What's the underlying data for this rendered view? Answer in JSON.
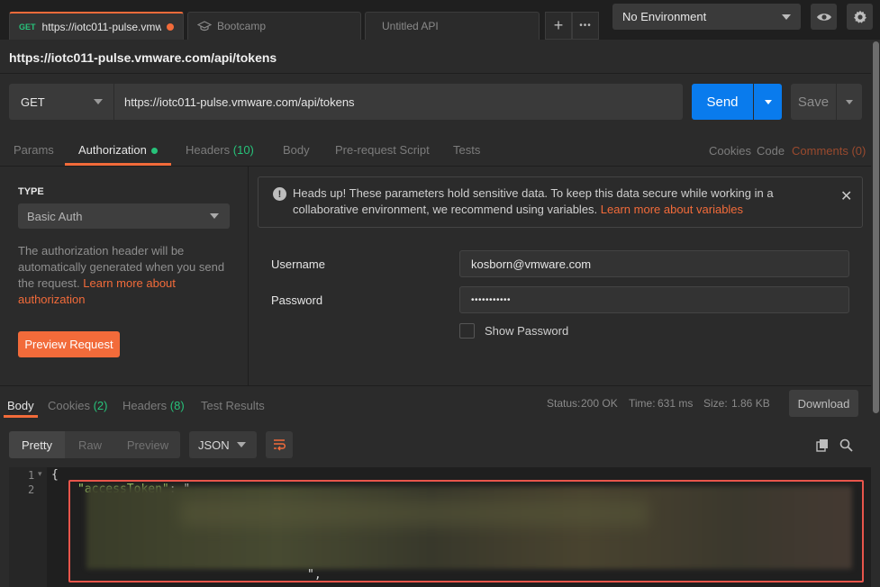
{
  "tabs": [
    {
      "method": "GET",
      "label": "https://iotc011-pulse.vmwa",
      "active": true
    },
    {
      "label": "Bootcamp"
    },
    {
      "label": "Untitled API"
    }
  ],
  "tabbar": {
    "add_label": "+",
    "more_label": "•••"
  },
  "environment": {
    "selected": "No Environment"
  },
  "request": {
    "title": "https://iotc011-pulse.vmware.com/api/tokens",
    "method": "GET",
    "url": "https://iotc011-pulse.vmware.com/api/tokens",
    "send_label": "Send",
    "save_label": "Save"
  },
  "request_tabs": {
    "params": "Params",
    "authorization": "Authorization",
    "headers": "Headers",
    "headers_count": "(10)",
    "body": "Body",
    "prerequest": "Pre-request Script",
    "tests": "Tests",
    "cookies": "Cookies",
    "code": "Code",
    "comments": "Comments (0)"
  },
  "auth": {
    "type_label": "TYPE",
    "type_value": "Basic Auth",
    "desc": "The authorization header will be automatically generated when you send the request. ",
    "desc_link": "Learn more about authorization",
    "preview_label": "Preview Request",
    "notice": "Heads up! These parameters hold sensitive data. To keep this data secure while working in a collaborative environment, we recommend using variables. ",
    "notice_link": "Learn more about variables",
    "username_label": "Username",
    "username_value": "kosborn@vmware.com",
    "password_label": "Password",
    "password_value": "•••••••••••",
    "show_password": "Show Password"
  },
  "response": {
    "tabs": {
      "body": "Body",
      "cookies": "Cookies",
      "cookies_count": "(2)",
      "headers": "Headers",
      "headers_count": "(8)",
      "tests": "Test Results"
    },
    "status_label": "Status:",
    "status_value": "200 OK",
    "time_label": "Time:",
    "time_value": "631 ms",
    "size_label": "Size:",
    "size_value": "1.86 KB",
    "download_label": "Download",
    "view": {
      "pretty": "Pretty",
      "raw": "Raw",
      "preview": "Preview",
      "format": "JSON"
    },
    "code": {
      "line1": "{",
      "line2_key": "\"accessToken\"",
      "line2_rest": ": \"",
      "line_end": "\","
    },
    "line_numbers": [
      "1",
      "2"
    ]
  },
  "colors": {
    "accent": "#f26b3a",
    "send": "#097bed",
    "success": "#27c27a",
    "highlight_box": "#e8554b"
  }
}
